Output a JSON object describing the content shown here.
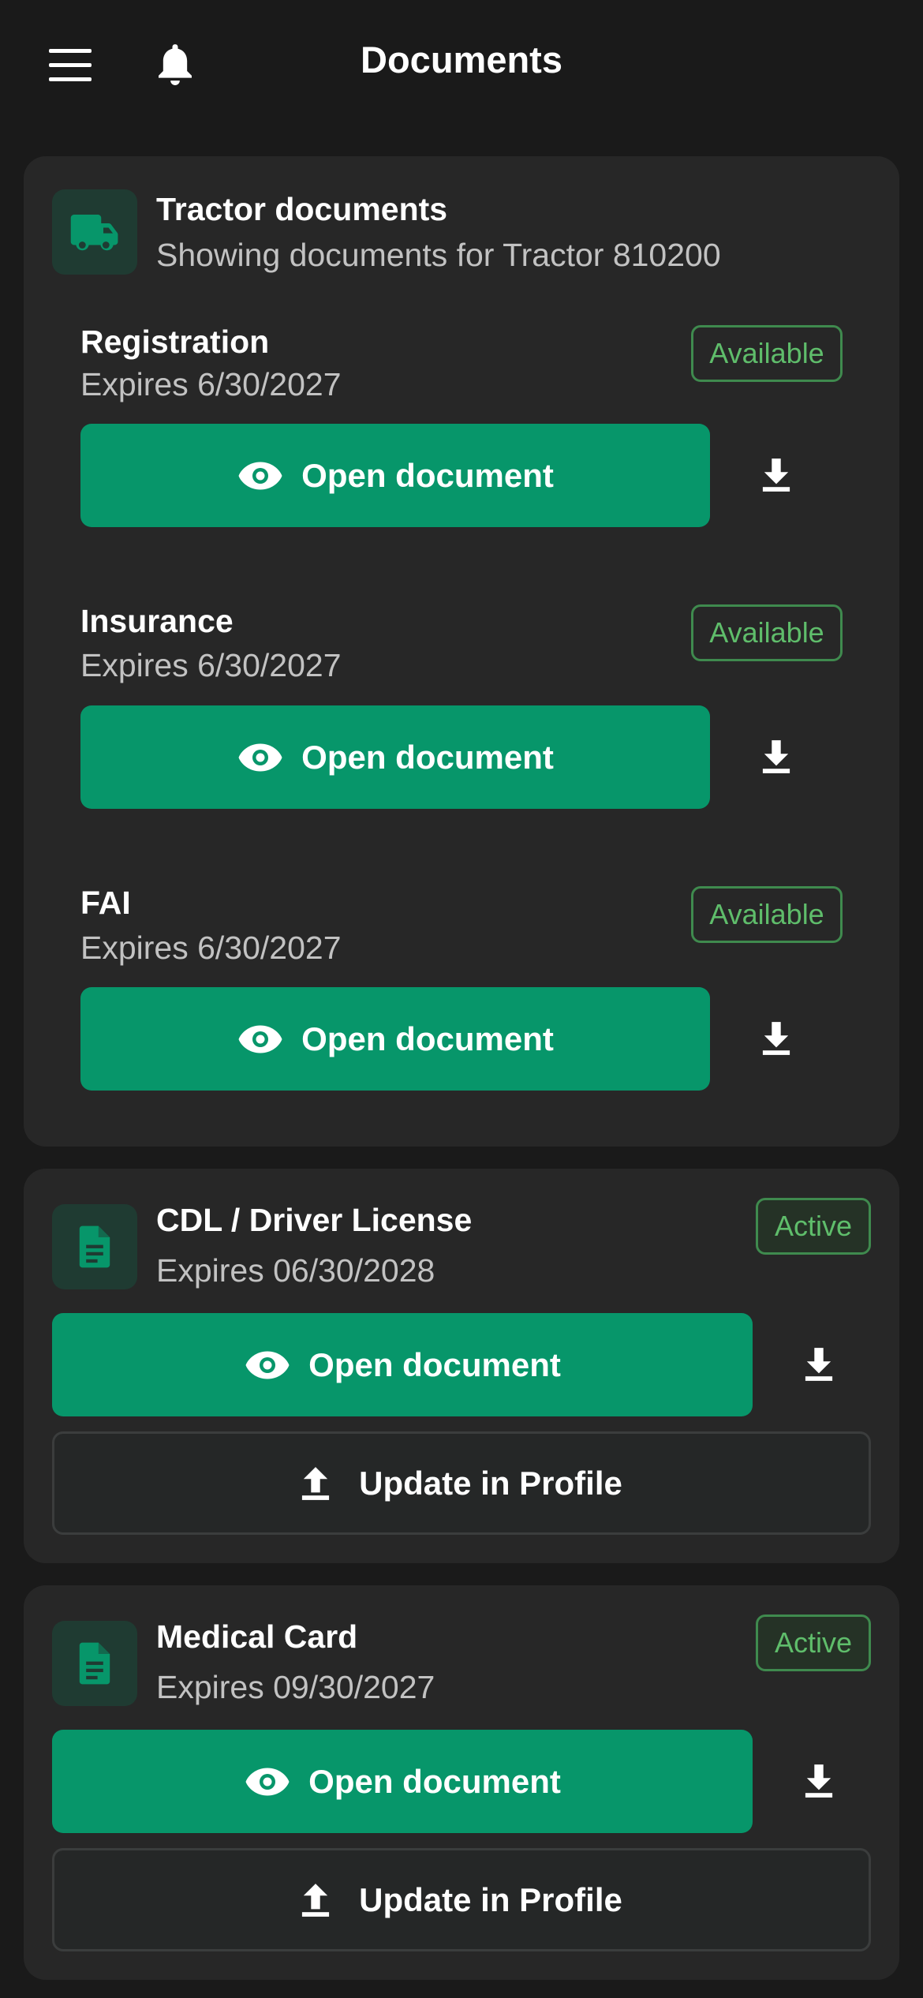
{
  "header": {
    "title": "Documents"
  },
  "tractor": {
    "title": "Tractor documents",
    "subtitle": "Showing documents for Tractor 810200",
    "docs": [
      {
        "name": "Registration",
        "expires": "Expires 6/30/2027",
        "status": "Available",
        "open_label": "Open document"
      },
      {
        "name": "Insurance",
        "expires": "Expires 6/30/2027",
        "status": "Available",
        "open_label": "Open document"
      },
      {
        "name": "FAI",
        "expires": "Expires 6/30/2027",
        "status": "Available",
        "open_label": "Open document"
      }
    ]
  },
  "cdl": {
    "title": "CDL / Driver License",
    "expires": "Expires 06/30/2028",
    "status": "Active",
    "open_label": "Open document",
    "update_label": "Update in Profile"
  },
  "medical": {
    "title": "Medical Card",
    "expires": "Expires 09/30/2027",
    "status": "Active",
    "open_label": "Open document",
    "update_label": "Update in Profile"
  },
  "colors": {
    "background": "#1a1a1a",
    "card": "#272727",
    "accent": "#07966a",
    "status_green": "#5fbd6b"
  }
}
